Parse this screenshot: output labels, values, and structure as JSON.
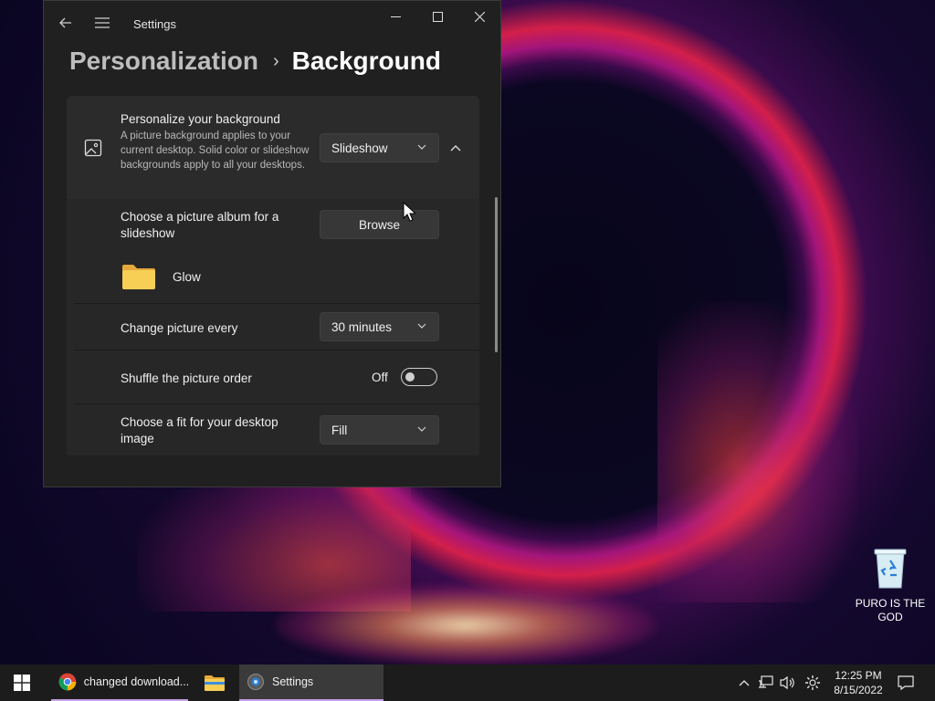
{
  "window": {
    "title": "Settings",
    "breadcrumb_parent": "Personalization",
    "breadcrumb_separator": "›",
    "breadcrumb_current": "Background"
  },
  "background_card": {
    "title": "Personalize your background",
    "description": "A picture background applies to your current desktop. Solid color or slideshow backgrounds apply to all your desktops.",
    "type_value": "Slideshow"
  },
  "album": {
    "label": "Choose a picture album for a slideshow",
    "browse_label": "Browse",
    "folder_name": "Glow"
  },
  "interval": {
    "label": "Change picture every",
    "value": "30 minutes"
  },
  "shuffle": {
    "label": "Shuffle the picture order",
    "state_label": "Off",
    "on": false
  },
  "fit": {
    "label": "Choose a fit for your desktop image",
    "value": "Fill"
  },
  "desktop": {
    "recycle_bin_label": "PURO IS THE GOD"
  },
  "taskbar": {
    "chrome_label": "changed download...",
    "settings_label": "Settings",
    "time": "12:25 PM",
    "date": "8/15/2022"
  },
  "colors": {
    "window_bg": "#202020",
    "card_bg": "#2b2b2b",
    "accent": "#c8a0e8"
  }
}
